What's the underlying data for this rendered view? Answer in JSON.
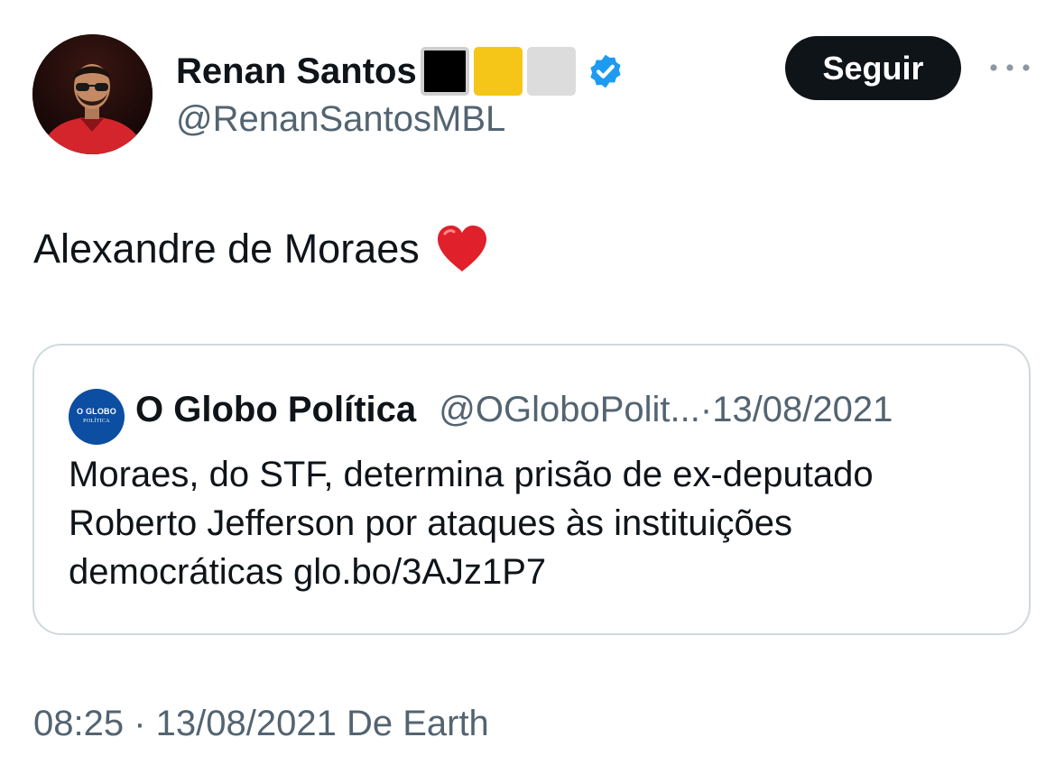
{
  "author": {
    "name": "Renan Santos",
    "handle": "@RenanSantosMBL",
    "flag_colors": [
      "#000000",
      "#f5c518",
      "#dcdcdc"
    ],
    "verified_color": "#1d9bf0",
    "avatar_icon": "person-photo"
  },
  "actions": {
    "follow_label": "Seguir",
    "more_icon": "ellipsis-icon"
  },
  "tweet": {
    "text": "Alexandre de Moraes",
    "emoji": "red-heart",
    "heart_color": "#e0202a"
  },
  "quote": {
    "avatar_logo_line1": "O GLOBO",
    "avatar_logo_line2": "POLÍTICA",
    "avatar_color": "#0b4ea2",
    "name": "O Globo Política",
    "handle": "@OGloboPolit...",
    "separator": "·",
    "date": "13/08/2021",
    "body_lines": [
      "Moraes, do STF, determina prisão de ex-deputado",
      "Roberto Jefferson por ataques às instituições",
      "democráticas  glo.bo/3AJz1P7"
    ]
  },
  "footer": {
    "timestamp": "08:25 · 13/08/2021 De Earth"
  }
}
